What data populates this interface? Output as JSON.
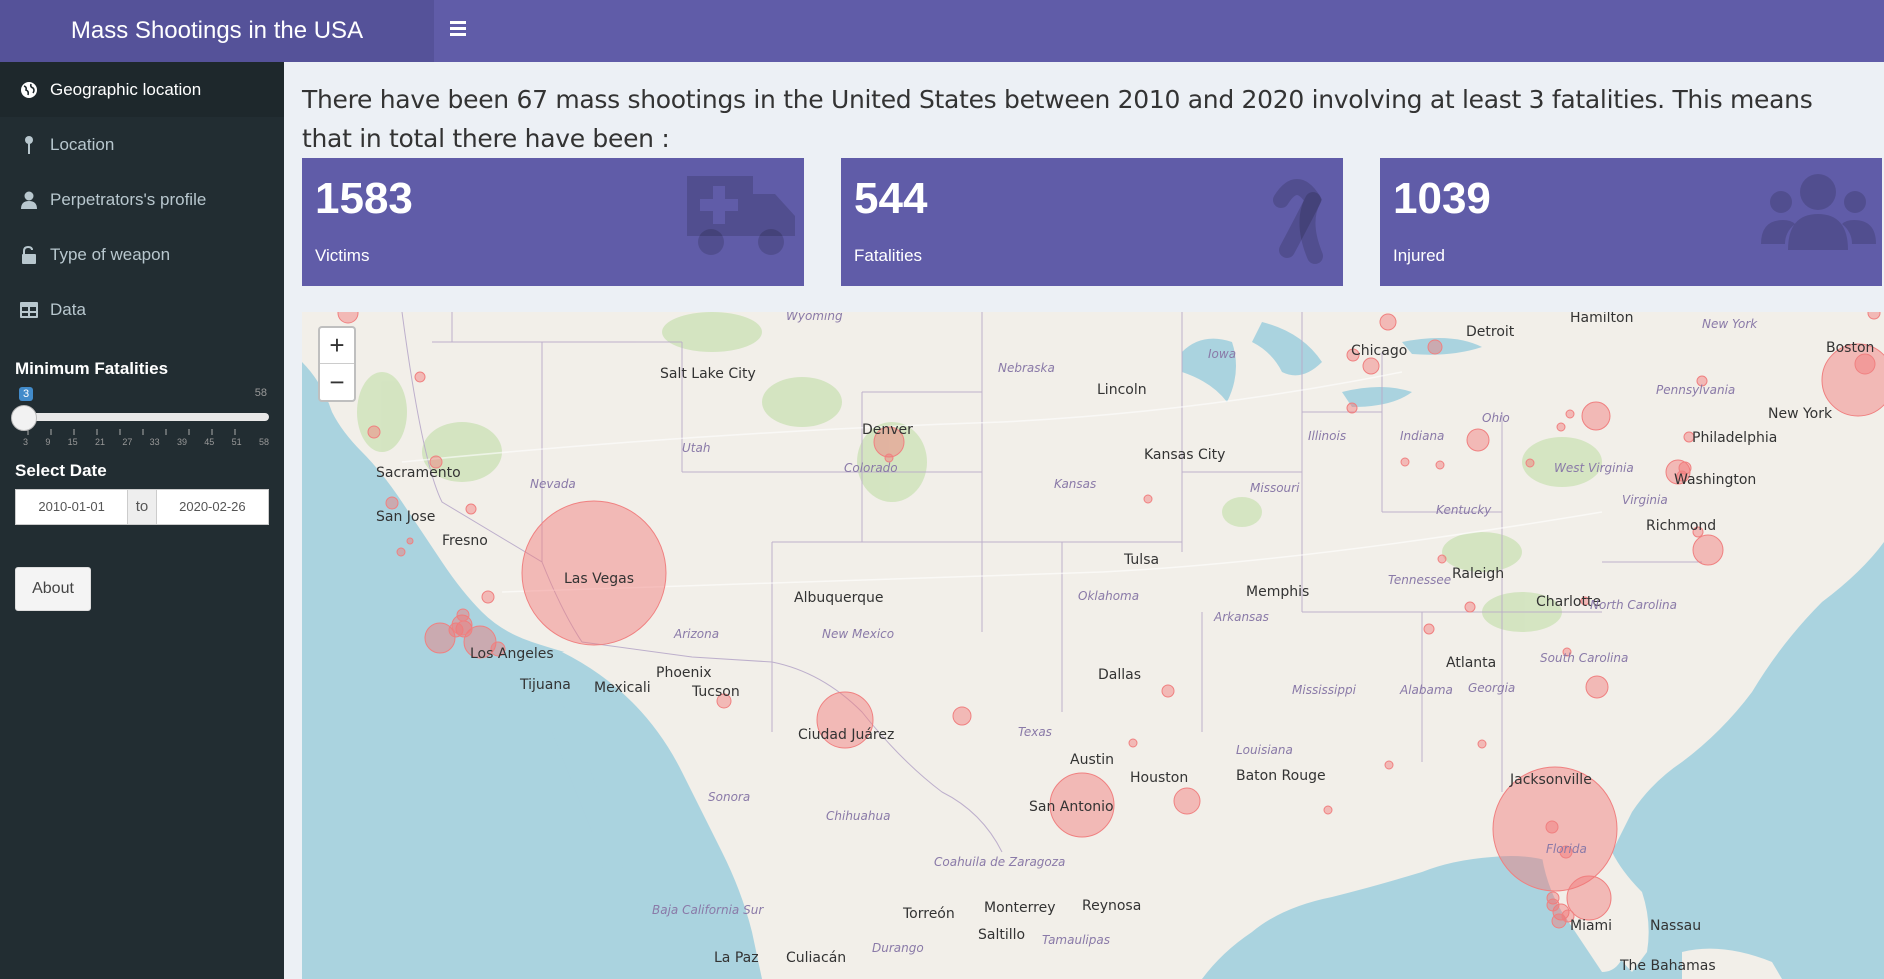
{
  "header": {
    "title": "Mass Shootings in the USA",
    "toggle_icon": "bars-icon"
  },
  "sidebar": {
    "items": [
      {
        "label": "Geographic location",
        "icon": "globe-icon",
        "active": true
      },
      {
        "label": "Location",
        "icon": "map-pin-icon",
        "active": false
      },
      {
        "label": "Perpetrators's profile",
        "icon": "user-icon",
        "active": false
      },
      {
        "label": "Type of weapon",
        "icon": "unlock-icon",
        "active": false
      },
      {
        "label": "Data",
        "icon": "table-icon",
        "active": false
      }
    ],
    "fatalities": {
      "label": "Minimum Fatalities",
      "min": "3",
      "max": "58",
      "value": 3,
      "ticks": [
        "3",
        "9",
        "15",
        "21",
        "27",
        "33",
        "39",
        "45",
        "51",
        "58"
      ]
    },
    "date": {
      "label": "Select Date",
      "start": "2010-01-01",
      "separator": "to",
      "end": "2020-02-26"
    },
    "about_label": "About"
  },
  "intro": "There have been 67 mass shootings in the United States between 2010 and 2020 involving at least 3 fatalities. This means that in total there have been :",
  "value_boxes": [
    {
      "value": "1583",
      "subtitle": "Victims",
      "icon": "ambulance-icon"
    },
    {
      "value": "544",
      "subtitle": "Fatalities",
      "icon": "ribbon-icon"
    },
    {
      "value": "1039",
      "subtitle": "Injured",
      "icon": "users-icon"
    }
  ],
  "map": {
    "zoom_in": "+",
    "zoom_out": "−",
    "cities": [
      "Salt Lake City",
      "Denver",
      "Lincoln",
      "Kansas City",
      "Chicago",
      "Detroit",
      "Hamilton",
      "Boston",
      "New York",
      "Philadelphia",
      "Washington",
      "Richmond",
      "Raleigh",
      "Charlotte",
      "Atlanta",
      "Memphis",
      "Tulsa",
      "Albuquerque",
      "Dallas",
      "Austin",
      "Houston",
      "San Antonio",
      "Baton Rouge",
      "Jacksonville",
      "Miami",
      "Nassau",
      "Las Vegas",
      "Sacramento",
      "San Jose",
      "Fresno",
      "Los Angeles",
      "Tijuana",
      "Mexicali",
      "Phoenix",
      "Tucson",
      "Ciudad Juárez",
      "Torreón",
      "Monterrey",
      "Reynosa",
      "Saltillo",
      "La Paz",
      "Culiacán",
      "The Bahamas"
    ],
    "regions": [
      "Wyoming",
      "Nebraska",
      "Iowa",
      "Utah",
      "Colorado",
      "Kansas",
      "Missouri",
      "Illinois",
      "Indiana",
      "Ohio",
      "Pennsylvania",
      "West Virginia",
      "Virginia",
      "Kentucky",
      "Tennessee",
      "North Carolina",
      "South Carolina",
      "Georgia",
      "Alabama",
      "Mississippi",
      "Arkansas",
      "Oklahoma",
      "Texas",
      "Louisiana",
      "New Mexico",
      "Arizona",
      "Nevada",
      "Florida",
      "Sonora",
      "Chihuahua",
      "Coahuila de Zaragoza",
      "Baja California Sur",
      "Durango",
      "Tamaulipas",
      "New York"
    ],
    "marker_color": "#f28c8c"
  }
}
